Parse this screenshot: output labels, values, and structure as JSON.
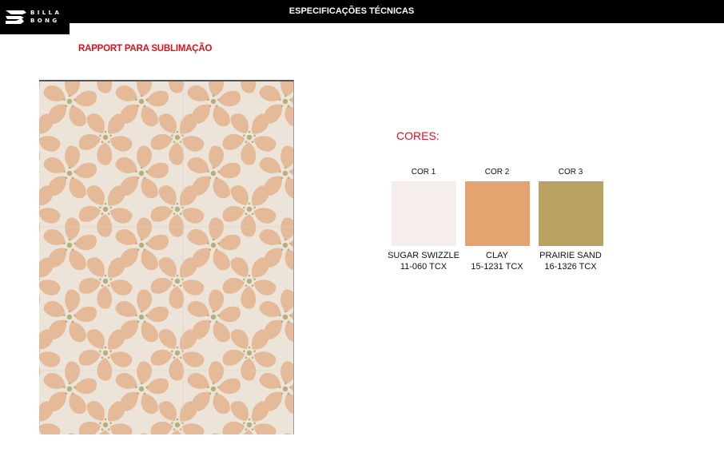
{
  "header": {
    "title": "ESPECIFICAÇÕES TÉCNICAS",
    "logo_text": "BILLA\nBONG"
  },
  "section": {
    "title": "RAPPORT PARA SUBLIMAÇÃO"
  },
  "pattern": {
    "background": "#ece4d8",
    "petal_color": "#e5ba98",
    "center_color": "#b8ae7d"
  },
  "colors": {
    "heading": "CORES:",
    "swatches": [
      {
        "label": "COR 1",
        "name": "SUGAR SWIZZLE",
        "code": "11-060 TCX",
        "hex": "#f6eeea"
      },
      {
        "label": "COR 2",
        "name": "CLAY",
        "code": "15-1231 TCX",
        "hex": "#e4a46f"
      },
      {
        "label": "COR 3",
        "name": "PRAIRIE SAND",
        "code": "16-1326 TCX",
        "hex": "#b9a162"
      }
    ]
  }
}
